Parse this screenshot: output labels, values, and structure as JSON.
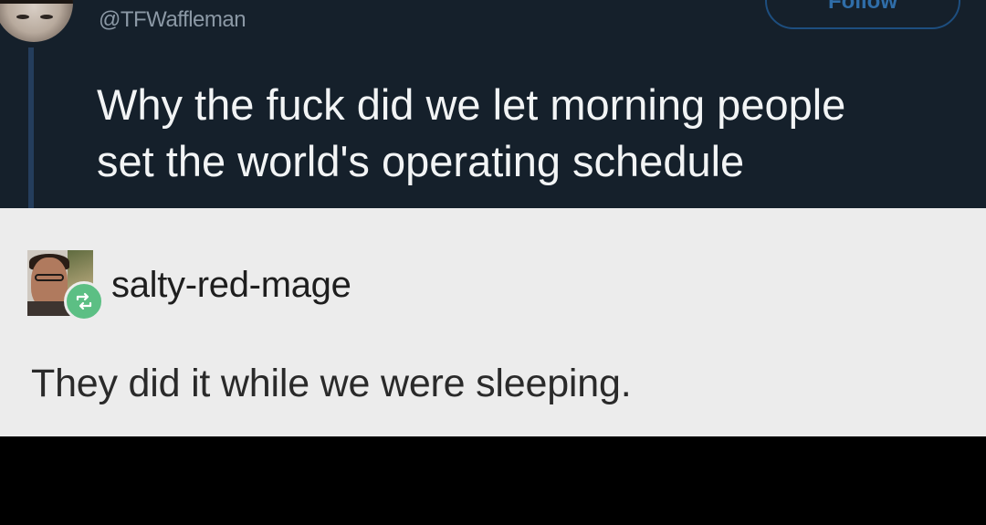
{
  "tweet": {
    "handle": "@TFWaffleman",
    "follow_label": "Follow",
    "text_line1": "Why the fuck did we let morning people",
    "text_line2": "set the world's operating schedule"
  },
  "reblog": {
    "username": "salty-red-mage",
    "text": "They did it while we were sleeping.",
    "badge_icon": "reblog-icon"
  },
  "colors": {
    "tweet_background": "#15202b",
    "reblog_background": "#ececec",
    "reblog_badge": "#5cbf84"
  }
}
